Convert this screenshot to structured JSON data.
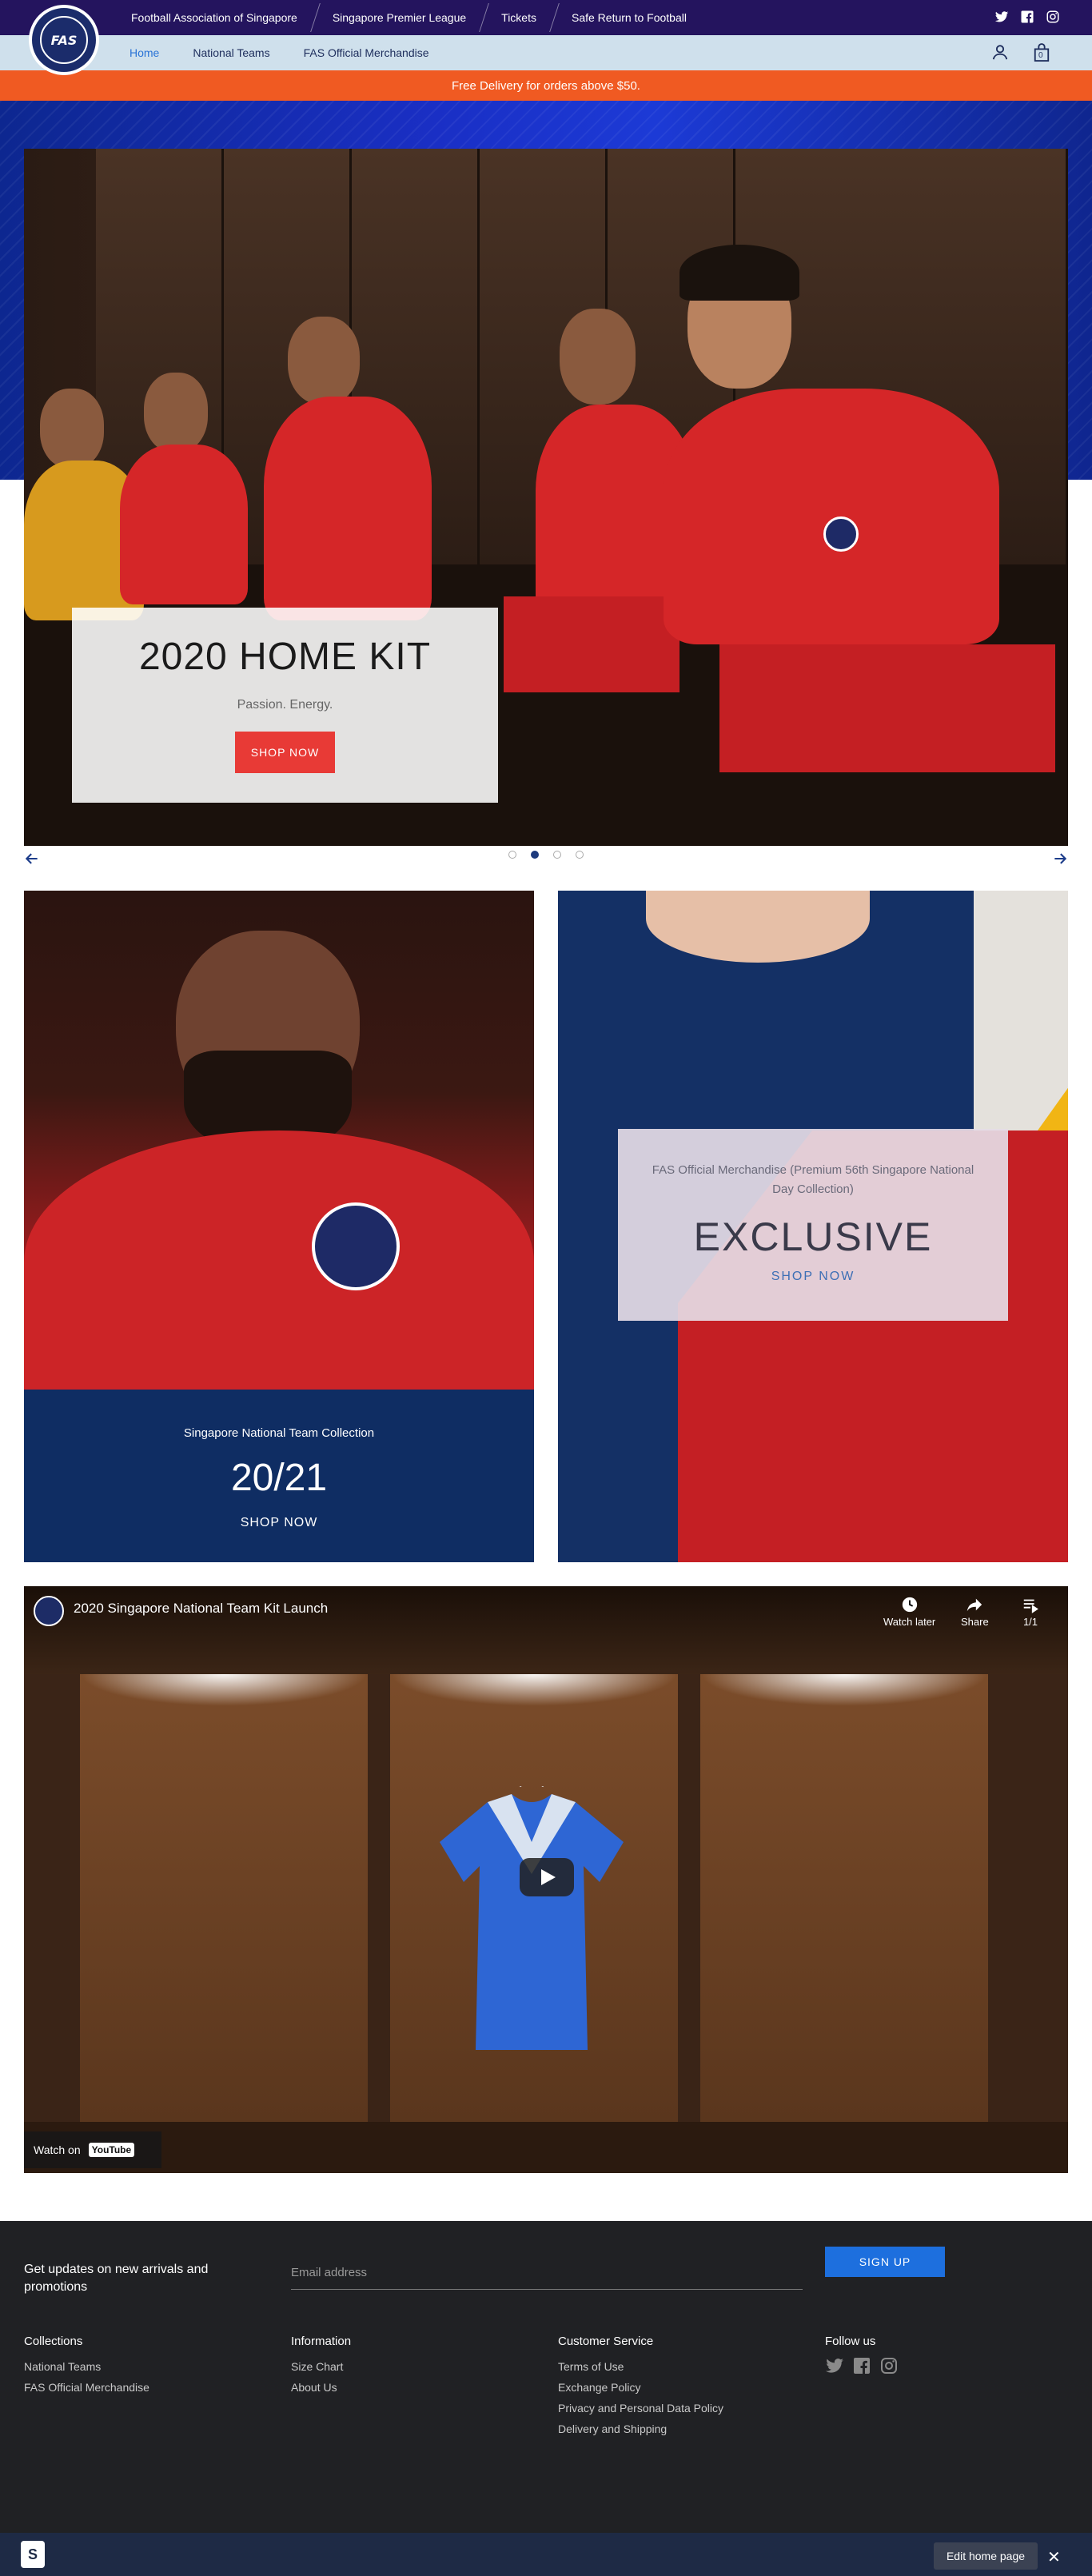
{
  "topbar": {
    "links": [
      "Football Association of Singapore",
      "Singapore Premier League",
      "Tickets",
      "Safe Return to Football"
    ],
    "social_icons": [
      "twitter-icon",
      "facebook-icon",
      "instagram-icon"
    ]
  },
  "logo": {
    "text": "FAS"
  },
  "nav": {
    "links": [
      "Home",
      "National Teams",
      "FAS Official Merchandise"
    ],
    "active": "Home",
    "icons": [
      "account-icon",
      "cart-icon"
    ],
    "cart_count": "0"
  },
  "promo": {
    "text": "Free Delivery for orders above $50."
  },
  "hero": {
    "title": "2020 HOME KIT",
    "subtitle": "Passion. Energy.",
    "button": "SHOP NOW",
    "slide_count": 4,
    "active_slide": 2
  },
  "collection_tile": {
    "label": "Singapore National Team Collection",
    "headline": "20/21",
    "link": "SHOP NOW"
  },
  "exclusive_tile": {
    "label": "FAS Official Merchandise (Premium 56th Singapore National Day Collection)",
    "headline": "EXCLUSIVE",
    "link": "SHOP NOW"
  },
  "video": {
    "title": "2020 Singapore National Team Kit Launch",
    "watch_later": "Watch later",
    "share": "Share",
    "playlist": "1/1",
    "watch_on": "Watch on",
    "youtube": "YouTube"
  },
  "footer": {
    "newsletter_title": "Get updates on new arrivals and promotions",
    "email_placeholder": "Email address",
    "signup": "SIGN UP",
    "columns": [
      {
        "title": "Collections",
        "links": [
          "National Teams",
          "FAS Official Merchandise"
        ]
      },
      {
        "title": "Information",
        "links": [
          "Size Chart",
          "About Us"
        ]
      },
      {
        "title": "Customer Service",
        "links": [
          "Terms of Use",
          "Exchange Policy",
          "Privacy and Personal Data Policy",
          "Delivery and Shipping"
        ]
      },
      {
        "title": "Follow us",
        "links": []
      }
    ],
    "follow_icons": [
      "twitter-icon",
      "facebook-icon",
      "instagram-icon"
    ]
  },
  "admin_bar": {
    "edit_button": "Edit home page",
    "close": "✕"
  },
  "colors": {
    "topbar": "#24145e",
    "nav": "#cfe0ec",
    "promo": "#f05a22",
    "accent_red": "#e83a36",
    "footer": "#202124",
    "signup": "#1d6fde"
  }
}
